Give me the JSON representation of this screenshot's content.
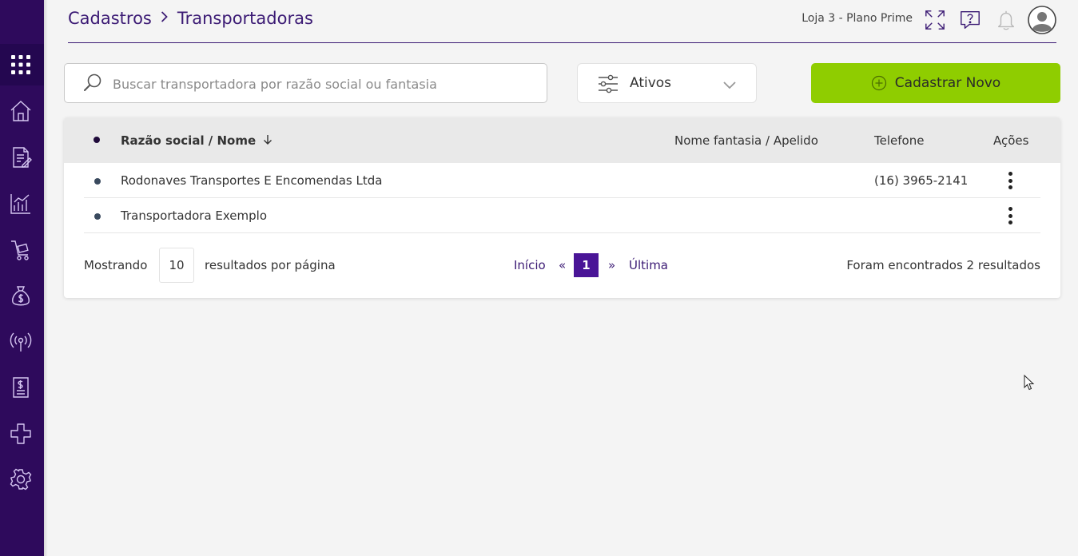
{
  "header": {
    "breadcrumb": [
      "Cadastros",
      "Transportadoras"
    ],
    "store": "Loja 3 - Plano Prime"
  },
  "toolbar": {
    "search_placeholder": "Buscar transportadora por razão social ou fantasia",
    "search_value": "",
    "filter_label": "Ativos",
    "new_label": "Cadastrar Novo"
  },
  "table": {
    "columns": [
      "Razão social / Nome",
      "Nome fantasia / Apelido",
      "Telefone",
      "Ações"
    ],
    "rows": [
      {
        "razao": "Rodonaves Transportes E Encomendas Ltda",
        "fantasia": "",
        "telefone": "(16) 3965-2141"
      },
      {
        "razao": "Transportadora Exemplo",
        "fantasia": "",
        "telefone": ""
      }
    ]
  },
  "pagination": {
    "showing_label": "Mostrando",
    "page_size": "10",
    "per_page_label": "resultados por página",
    "first": "Início",
    "prev": "«",
    "current": "1",
    "next": "»",
    "last": "Última",
    "summary": "Foram encontrados 2 resultados"
  },
  "colors": {
    "sidebar": "#2e0a5c",
    "accent": "#3b1a74",
    "primary_button": "#8fcd00",
    "active_page": "#4a1597"
  },
  "icons": {
    "sidebar": [
      "apps-grid-icon",
      "home-icon",
      "document-edit-icon",
      "chart-icon",
      "cart-icon",
      "money-bag-icon",
      "broadcast-icon",
      "invoice-icon",
      "plugin-icon",
      "gear-icon"
    ],
    "header": [
      "expand-icon",
      "help-chat-icon",
      "bell-icon",
      "avatar"
    ]
  }
}
